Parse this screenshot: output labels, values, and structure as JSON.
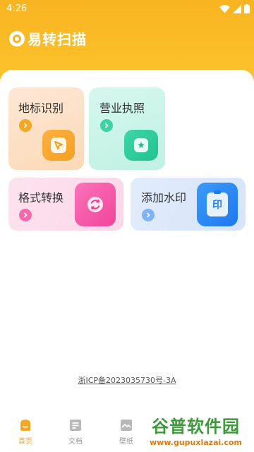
{
  "status": {
    "time": "4:26"
  },
  "app": {
    "title": "易转扫描"
  },
  "cards": {
    "landmark": {
      "label": "地标识别"
    },
    "license": {
      "label": "营业执照"
    },
    "format": {
      "label": "格式转换"
    },
    "watermark": {
      "label": "添加水印",
      "icon_text": "印"
    }
  },
  "footer": {
    "icp": "浙ICP备2023035730号-3A"
  },
  "tabs": [
    {
      "label": "首页",
      "icon": "home-icon",
      "active": true
    },
    {
      "label": "文档",
      "icon": "document-icon",
      "active": false
    },
    {
      "label": "壁纸",
      "icon": "wallpaper-icon",
      "active": false
    }
  ],
  "overlay": {
    "brand": "谷普软件园",
    "url": "www.gupuxlazai.com"
  },
  "colors": {
    "header": "#f8b421",
    "tab_active": "#f5a623",
    "tab_inactive": "#999999"
  }
}
